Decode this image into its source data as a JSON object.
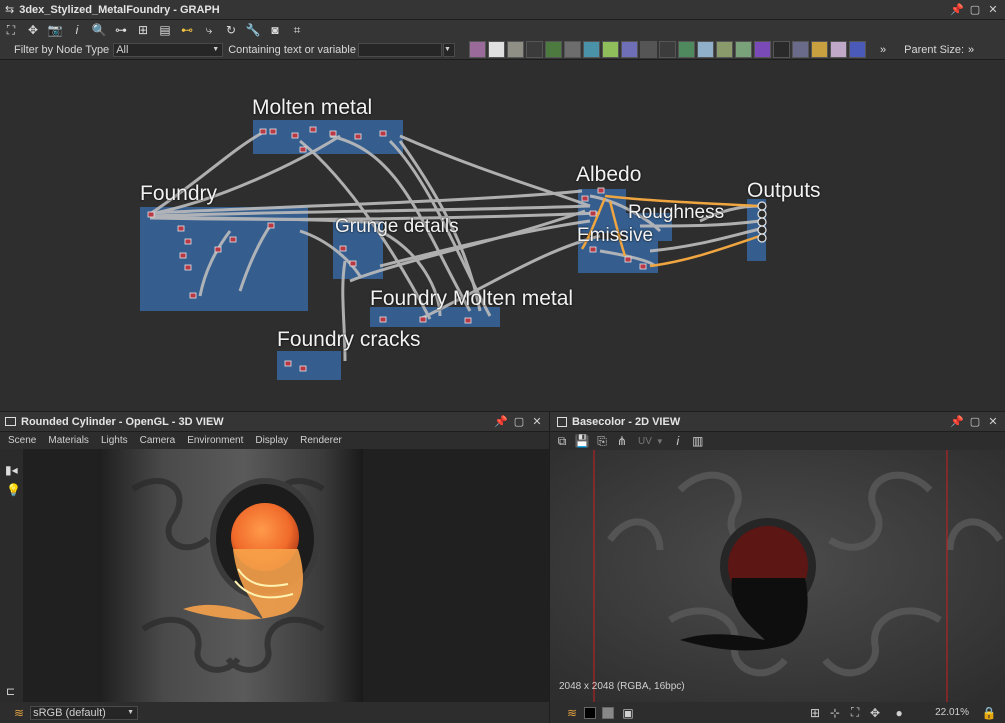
{
  "graph": {
    "title": "3dex_Stylized_MetalFoundry - GRAPH",
    "filter_label": "Filter by Node Type",
    "filter_value": "All",
    "containing_label": "Containing text or variable",
    "parent_size_label": "Parent Size:",
    "frames": [
      {
        "label": "Molten metal"
      },
      {
        "label": "Foundry"
      },
      {
        "label": "Grunge details"
      },
      {
        "label": "Albedo"
      },
      {
        "label": "Roughness"
      },
      {
        "label": "Emissive"
      },
      {
        "label": "Outputs"
      },
      {
        "label": "Foundry Molten metal"
      },
      {
        "label": "Foundry cracks"
      }
    ],
    "colors": {
      "frame": "#355e8f",
      "link": "#bdbdbd",
      "link_highlight": "#f0a640",
      "node": "#b83845"
    }
  },
  "view3d": {
    "title": "Rounded Cylinder - OpenGL - 3D VIEW",
    "menu": [
      "Scene",
      "Materials",
      "Lights",
      "Camera",
      "Environment",
      "Display",
      "Renderer"
    ],
    "colorspace": "sRGB (default)"
  },
  "view2d": {
    "title": "Basecolor - 2D VIEW",
    "uv_label": "UV",
    "info": "2048 x 2048 (RGBA, 16bpc)",
    "zoom": "22.01%"
  }
}
